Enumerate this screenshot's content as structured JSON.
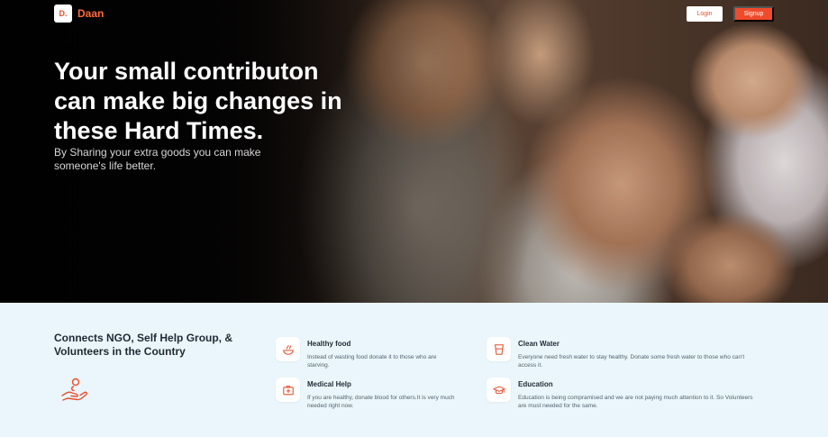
{
  "brand": {
    "logo_mark": "D.",
    "name": "Daan"
  },
  "nav": {
    "login_label": "Login",
    "signup_label": "Signup"
  },
  "hero": {
    "title": "Your small contributon can make big changes in these Hard Times.",
    "subtitle": "By Sharing your extra goods you can make someone's life better."
  },
  "features": {
    "heading": "Connects NGO, Self Help Group, & Volunteers in the Country",
    "items": [
      {
        "title": "Healthy food",
        "description": "Instead of wasting food donate it to those who are starving.",
        "icon": "food-bowl-icon"
      },
      {
        "title": "Clean Water",
        "description": "Everyone need fresh water to stay healthy. Donate some fresh water to those who can't access it.",
        "icon": "water-glass-icon"
      },
      {
        "title": "Medical Help",
        "description": "If you are healthy, donate blood for others.It is very much needed right now.",
        "icon": "medical-kit-icon"
      },
      {
        "title": "Education",
        "description": "Education is being compramised and we are not paying much attention to it. So Volunteers are must needed for the same.",
        "icon": "graduation-cap-icon"
      }
    ]
  },
  "colors": {
    "accent": "#f04a2b",
    "hero_bg": "#0b0a0a",
    "features_bg": "#eaf6fb",
    "heading_text": "#1f2a36"
  }
}
